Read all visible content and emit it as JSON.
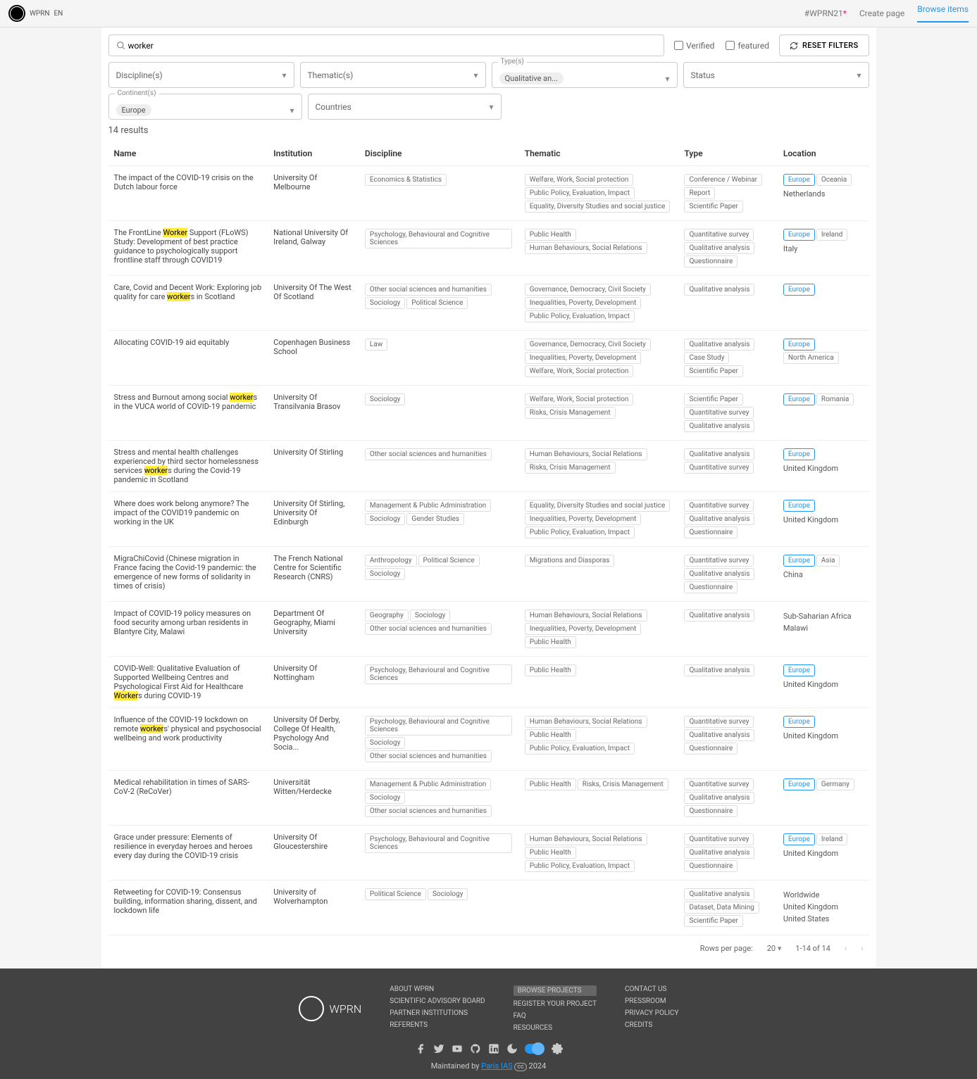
{
  "topbar": {
    "brand": "WPRN",
    "lang": "EN",
    "nav": {
      "wprn21": "#WPRN21",
      "star": "*",
      "create": "Create page",
      "browse": "Browse items"
    }
  },
  "search": {
    "value": "worker",
    "verified": "Verified",
    "featured": "featured",
    "reset": "RESET FILTERS"
  },
  "filters": {
    "discipline": "Discipline(s)",
    "thematic": "Thematic(s)",
    "types_label": "Type(s)",
    "types_value": "Qualitative an...",
    "status": "Status",
    "continent_label": "Continent(s)",
    "continent_value": "Europe",
    "countries": "Countries"
  },
  "results_count": "14 results",
  "headers": {
    "name": "Name",
    "institution": "Institution",
    "discipline": "Discipline",
    "thematic": "Thematic",
    "type": "Type",
    "location": "Location"
  },
  "highlight": "worker",
  "rows": [
    {
      "name": "The impact of the COVID-19 crisis on the Dutch labour force",
      "inst": "University Of Melbourne",
      "disc": [
        "Economics & Statistics"
      ],
      "them": [
        "Welfare, Work, Social protection",
        "Public Policy, Evaluation, Impact",
        "Equality, Diversity Studies and social justice"
      ],
      "type": [
        "Conference / Webinar",
        "Report",
        "Scientific Paper"
      ],
      "loc_tags": [
        "Europe",
        "Oceania"
      ],
      "loc_text": "Netherlands"
    },
    {
      "name": "The FrontLine Worker Support (FLoWS) Study: Development of best practice guidance to psychologically support frontline staff through COVID19",
      "inst": "National University Of Ireland, Galway",
      "disc": [
        "Psychology, Behavioural and Cognitive Sciences"
      ],
      "them": [
        "Public Health",
        "Human Behaviours, Social Relations"
      ],
      "type": [
        "Quantitative survey",
        "Qualitative analysis",
        "Questionnaire"
      ],
      "loc_tags": [
        "Europe",
        "Ireland"
      ],
      "loc_text": "Italy"
    },
    {
      "name": "Care, Covid and Decent Work: Exploring job quality for care workers in Scotland",
      "inst": "University Of The West Of Scotland",
      "disc": [
        "Other social sciences and humanities",
        "Sociology",
        "Political Science"
      ],
      "them": [
        "Governance, Democracy, Civil Society",
        "Inequalities, Poverty, Development",
        "Public Policy, Evaluation, Impact"
      ],
      "type": [
        "Qualitative analysis"
      ],
      "loc_tags": [
        "Europe"
      ],
      "loc_text": ""
    },
    {
      "name": "Allocating COVID-19 aid equitably",
      "inst": "Copenhagen Business School",
      "disc": [
        "Law"
      ],
      "them": [
        "Governance, Democracy, Civil Society",
        "Inequalities, Poverty, Development",
        "Welfare, Work, Social protection"
      ],
      "type": [
        "Qualitative analysis",
        "Case Study",
        "Scientific Paper"
      ],
      "loc_tags": [
        "Europe",
        "North America"
      ],
      "loc_text": ""
    },
    {
      "name": "Stress and Burnout among social workers in the VUCA world of COVID-19 pandemic",
      "inst": "University Of Transilvania Brasov",
      "disc": [
        "Sociology"
      ],
      "them": [
        "Welfare, Work, Social protection",
        "Risks, Crisis Management"
      ],
      "type": [
        "Scientific Paper",
        "Quantitative survey",
        "Qualitative analysis"
      ],
      "loc_tags": [
        "Europe",
        "Romania"
      ],
      "loc_text": ""
    },
    {
      "name": "Stress and mental health challenges experienced by third sector homelessness services workers during the Covid-19 pandemic in Scotland",
      "inst": "University Of Stirling",
      "disc": [
        "Other social sciences and humanities"
      ],
      "them": [
        "Human Behaviours, Social Relations",
        "Risks, Crisis Management"
      ],
      "type": [
        "Qualitative analysis",
        "Quantitative survey"
      ],
      "loc_tags": [
        "Europe"
      ],
      "loc_text": "United Kingdom"
    },
    {
      "name": "Where does work belong anymore? The impact of the COVID19 pandemic on working in the UK",
      "inst": "University Of Stirling, University Of Edinburgh",
      "disc": [
        "Management & Public Administration",
        "Sociology",
        "Gender Studies"
      ],
      "them": [
        "Equality, Diversity Studies and social justice",
        "Inequalities, Poverty, Development",
        "Public Policy, Evaluation, Impact"
      ],
      "type": [
        "Quantitative survey",
        "Qualitative analysis",
        "Questionnaire"
      ],
      "loc_tags": [
        "Europe"
      ],
      "loc_text": "United Kingdom"
    },
    {
      "name": "MigraChiCovid (Chinese migration in France facing the Covid-19 pandemic: the emergence of new forms of solidarity in times of crisis)",
      "inst": "The French National Centre for Scientific Research (CNRS)",
      "disc": [
        "Anthropology",
        "Political Science",
        "Sociology"
      ],
      "them": [
        "Migrations and Diasporas"
      ],
      "type": [
        "Quantitative survey",
        "Qualitative analysis",
        "Questionnaire"
      ],
      "loc_tags": [
        "Europe",
        "Asia"
      ],
      "loc_text": "China"
    },
    {
      "name": "Impact of COVID-19 policy measures on food security among urban residents in Blantyre City, Malawi",
      "inst": "Department Of Geography, Miami University",
      "disc": [
        "Geography",
        "Sociology",
        "Other social sciences and humanities"
      ],
      "them": [
        "Human Behaviours, Social Relations",
        "Inequalities, Poverty, Development",
        "Public Health"
      ],
      "type": [
        "Qualitative analysis"
      ],
      "loc_tags": [],
      "loc_text": "Sub-Saharian Africa\nMalawi"
    },
    {
      "name": "COVID-Well: Qualitative Evaluation of Supported Wellbeing Centres and Psychological First Aid for Healthcare Workers during COVID-19",
      "inst": "University Of Nottingham",
      "disc": [
        "Psychology, Behavioural and Cognitive Sciences"
      ],
      "them": [
        "Public Health"
      ],
      "type": [
        "Qualitative analysis"
      ],
      "loc_tags": [
        "Europe"
      ],
      "loc_text": "United Kingdom"
    },
    {
      "name": "Influence of the COVID-19 lockdown on remote workers' physical and psychosocial wellbeing and work productivity",
      "inst": "University Of Derby, College Of Health, Psychology And Socia...",
      "disc": [
        "Psychology, Behavioural and Cognitive Sciences",
        "Sociology",
        "Other social sciences and humanities"
      ],
      "them": [
        "Human Behaviours, Social Relations",
        "Public Health",
        "Public Policy, Evaluation, Impact"
      ],
      "type": [
        "Quantitative survey",
        "Qualitative analysis",
        "Questionnaire"
      ],
      "loc_tags": [
        "Europe"
      ],
      "loc_text": "United Kingdom"
    },
    {
      "name": "Medical rehabilitation in times of SARS-CoV-2 (ReCoVer)",
      "inst": "Universität Witten/Herdecke",
      "disc": [
        "Management & Public Administration",
        "Sociology",
        "Other social sciences and humanities"
      ],
      "them": [
        "Public Health",
        "Risks, Crisis Management"
      ],
      "type": [
        "Quantitative survey",
        "Qualitative analysis",
        "Questionnaire"
      ],
      "loc_tags": [
        "Europe",
        "Germany"
      ],
      "loc_text": ""
    },
    {
      "name": "Grace under pressure: Elements of resilience in everyday heroes and heroes every day during the COVID-19 crisis",
      "inst": "University Of Gloucestershire",
      "disc": [
        "Psychology, Behavioural and Cognitive Sciences"
      ],
      "them": [
        "Human Behaviours, Social Relations",
        "Public Health",
        "Public Policy, Evaluation, Impact"
      ],
      "type": [
        "Quantitative survey",
        "Qualitative analysis",
        "Questionnaire"
      ],
      "loc_tags": [
        "Europe",
        "Ireland"
      ],
      "loc_text": "United Kingdom"
    },
    {
      "name": "Retweeting for COVID-19: Consensus building, information sharing, dissent, and lockdown life",
      "inst": "University of Wolverhampton",
      "disc": [
        "Political Science",
        "Sociology"
      ],
      "them": [],
      "type": [
        "Qualitative analysis",
        "Dataset, Data Mining",
        "Scientific Paper"
      ],
      "loc_tags": [],
      "loc_text": "Worldwide\nUnited Kingdom\nUnited States"
    }
  ],
  "pagination": {
    "rows_label": "Rows per page:",
    "rows_value": "20",
    "range": "1-14 of 14"
  },
  "footer": {
    "brand": "WPRN",
    "col1": [
      "ABOUT WPRN",
      "SCIENTIFIC ADVISORY BOARD",
      "PARTNER INSTITUTIONS",
      "REFERENTS"
    ],
    "col2": [
      "BROWSE PROJECTS",
      "REGISTER YOUR PROJECT",
      "FAQ",
      "RESOURCES"
    ],
    "col3": [
      "CONTACT US",
      "PRESSROOM",
      "PRIVACY POLICY",
      "CREDITS"
    ],
    "bottom_prefix": "Maintained by ",
    "bottom_link": "Paris IAS",
    "bottom_suffix": " 2024"
  }
}
